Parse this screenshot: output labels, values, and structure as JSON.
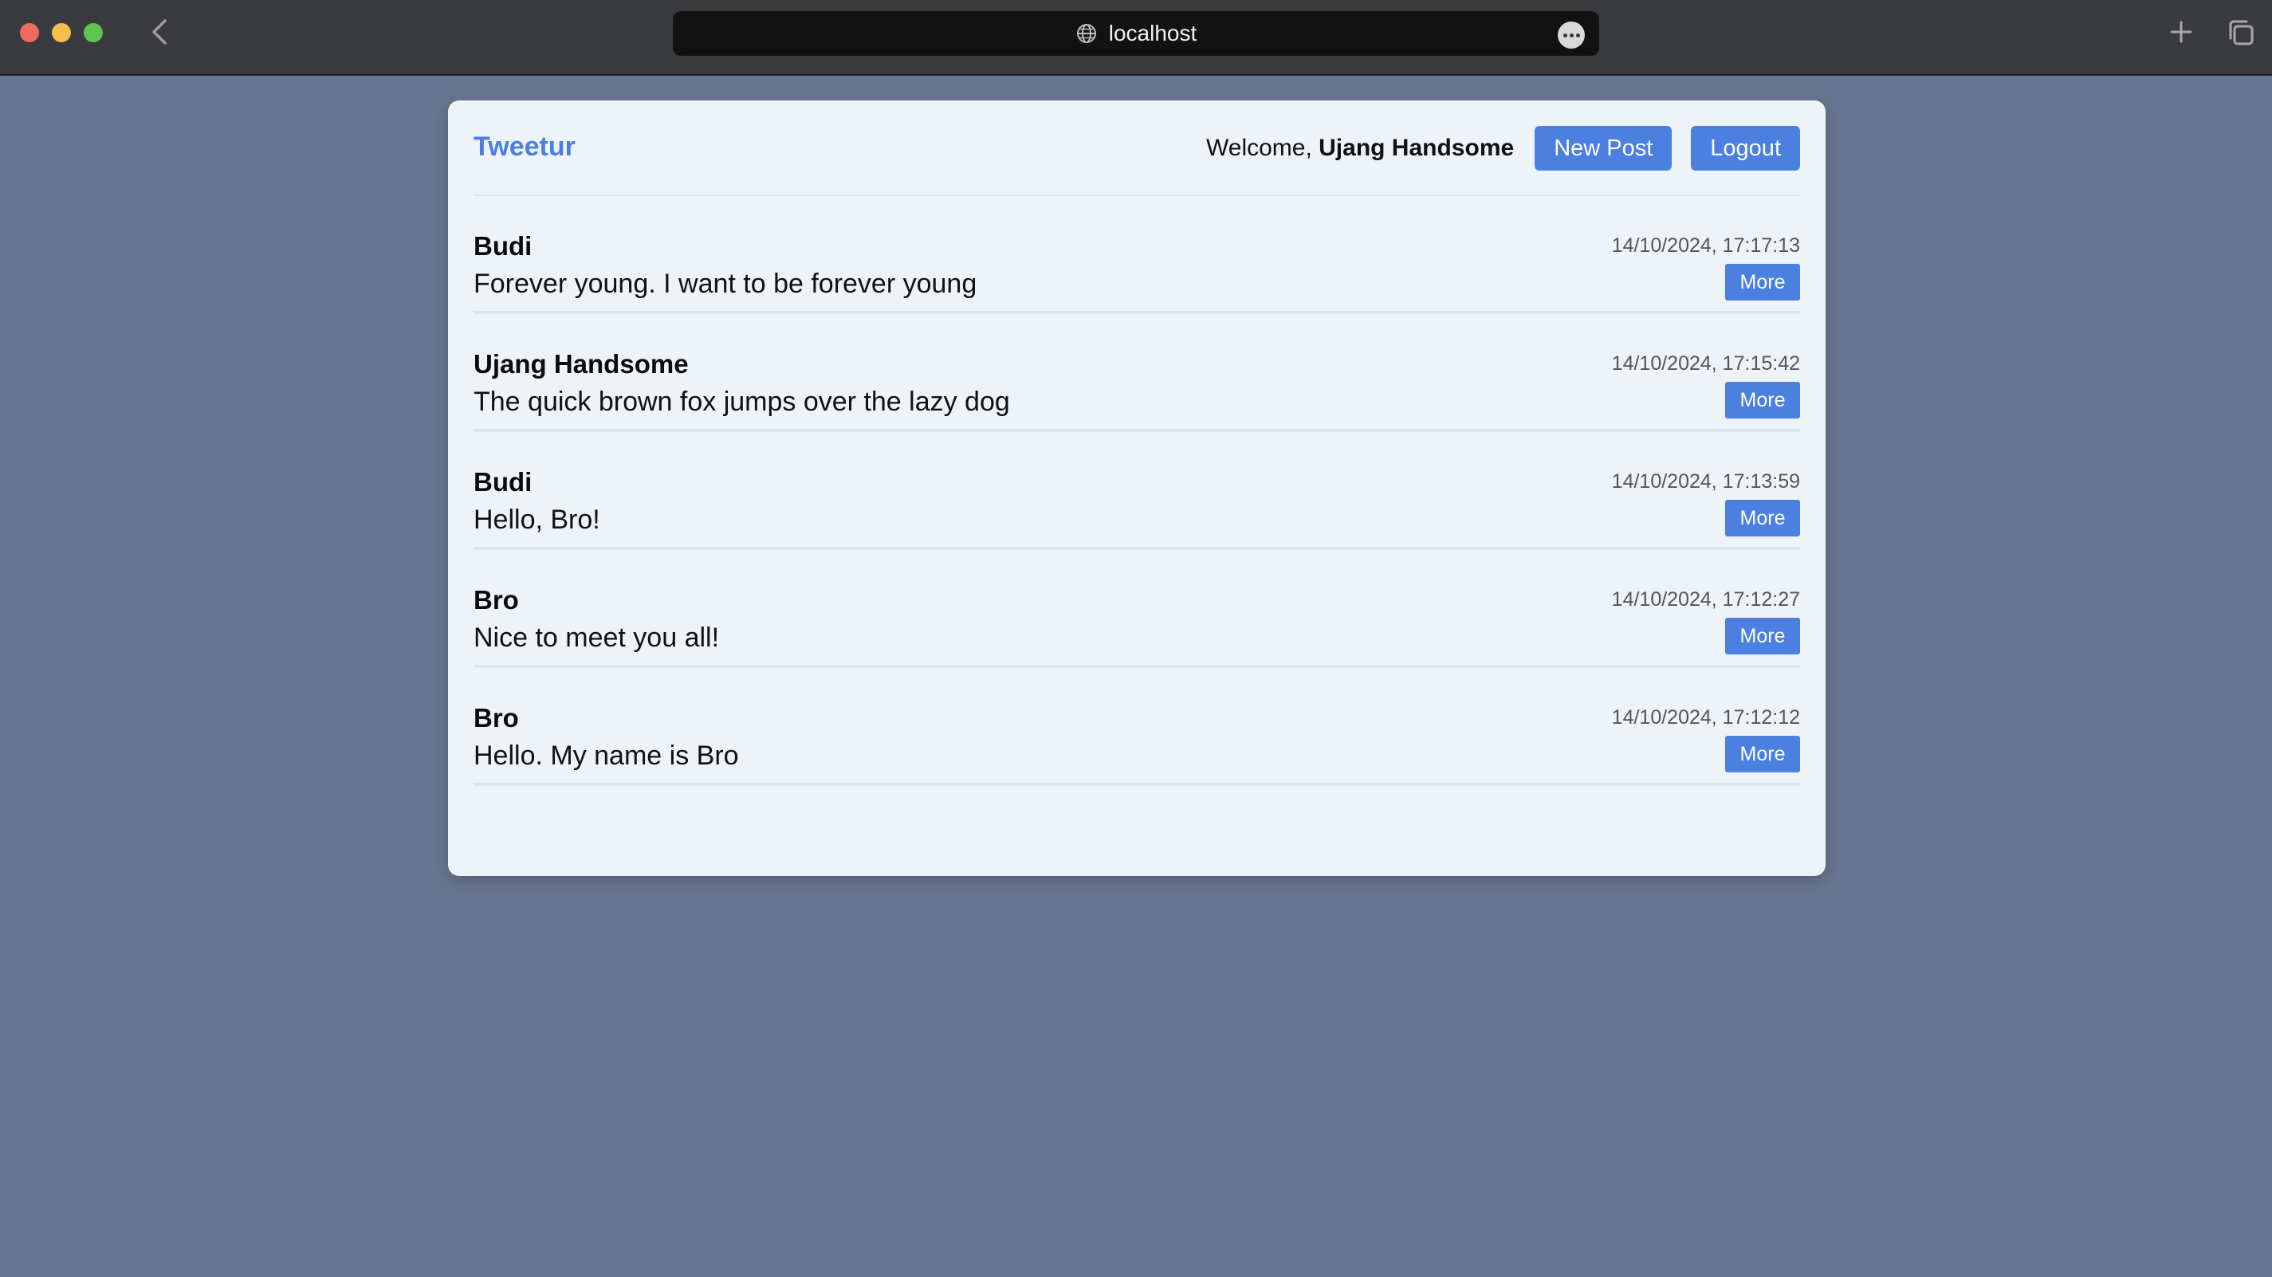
{
  "browser": {
    "url": "localhost",
    "colors": {
      "chrome": "#3a3b3e",
      "urlbar": "#121212",
      "close": "#ed6a5e",
      "minimize": "#f4bf4f",
      "zoom": "#61c554"
    },
    "icons": [
      "back-arrow-icon",
      "globe-icon",
      "more-icon",
      "plus-icon",
      "tabs-icon"
    ]
  },
  "app": {
    "brand": "Tweetur",
    "welcome_prefix": "Welcome, ",
    "user_name": "Ujang Handsome",
    "new_post_label": "New Post",
    "logout_label": "Logout",
    "colors": {
      "accent": "#4b7fe0",
      "background": "#687590",
      "card": "#eef3f8"
    }
  },
  "posts": [
    {
      "author": "Budi",
      "text": "Forever young. I want to be forever young",
      "time": "14/10/2024, 17:17:13",
      "action": "More"
    },
    {
      "author": "Ujang Handsome",
      "text": "The quick brown fox jumps over the lazy dog",
      "time": "14/10/2024, 17:15:42",
      "action": "More"
    },
    {
      "author": "Budi",
      "text": "Hello, Bro!",
      "time": "14/10/2024, 17:13:59",
      "action": "More"
    },
    {
      "author": "Bro",
      "text": "Nice to meet you all!",
      "time": "14/10/2024, 17:12:27",
      "action": "More"
    },
    {
      "author": "Bro",
      "text": "Hello. My name is Bro",
      "time": "14/10/2024, 17:12:12",
      "action": "More"
    }
  ]
}
